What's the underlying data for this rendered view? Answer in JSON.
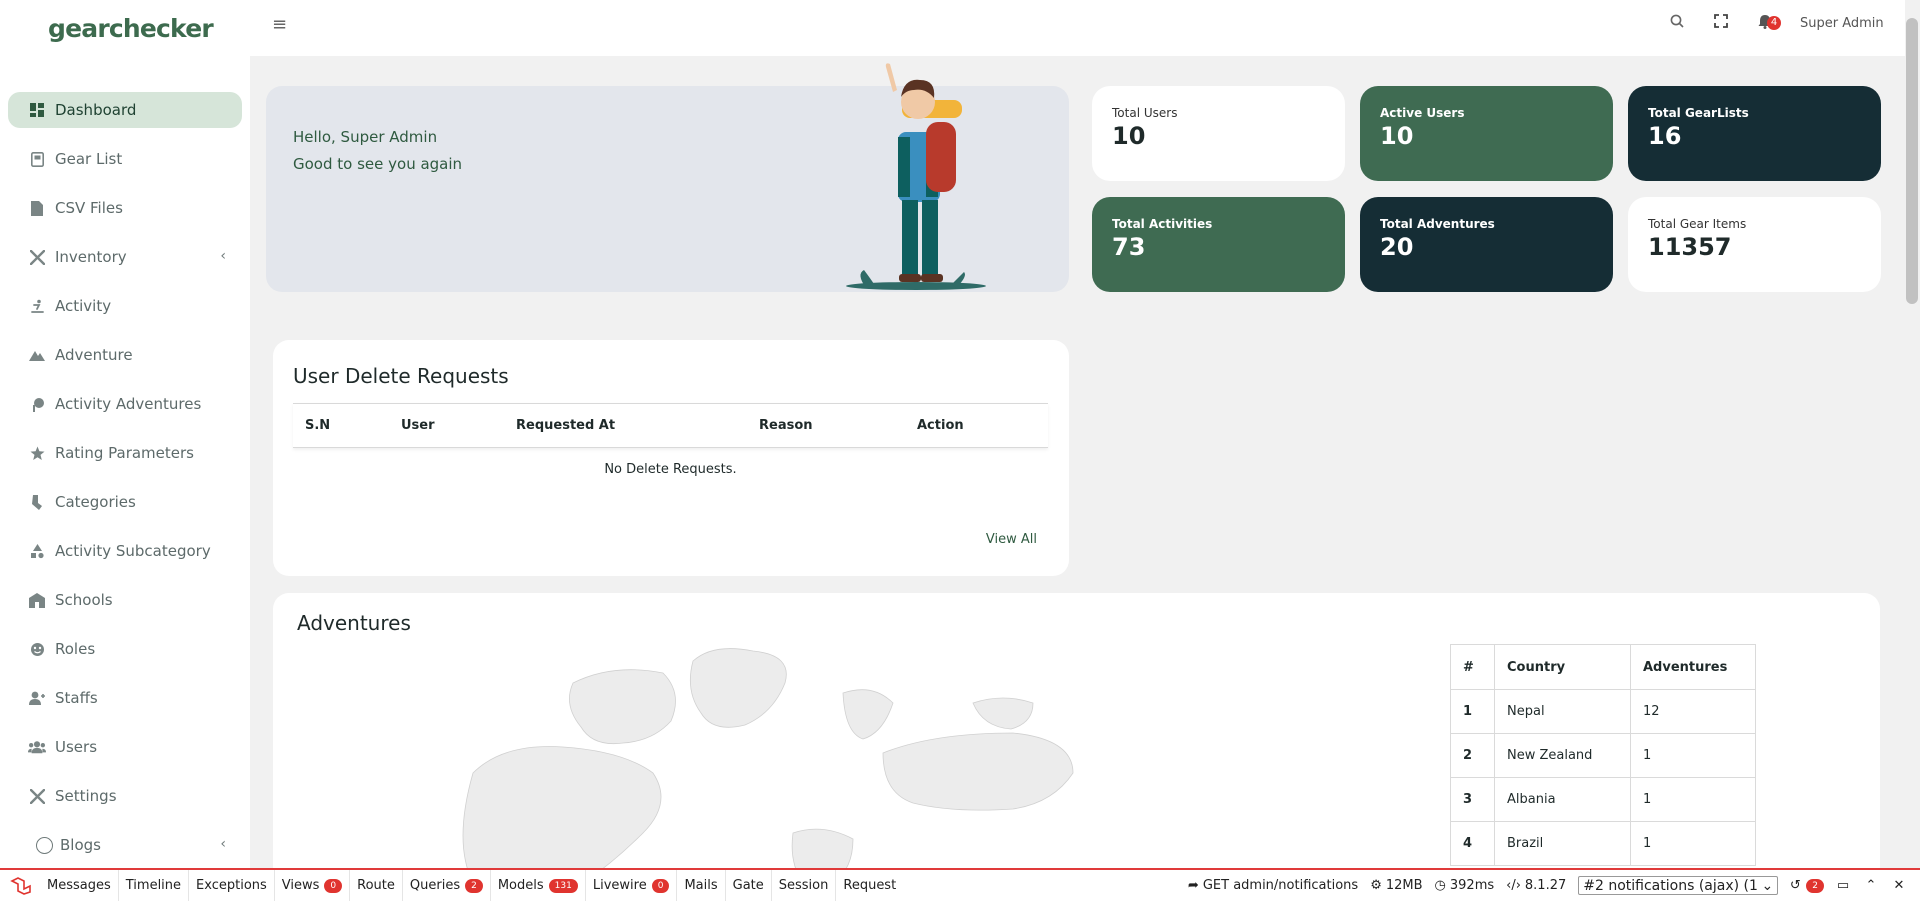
{
  "app": {
    "logo": "gearchecker"
  },
  "sidebar": {
    "items": [
      {
        "label": "Dashboard",
        "icon": "dashboard-icon",
        "active": true
      },
      {
        "label": "Gear List",
        "icon": "list-icon"
      },
      {
        "label": "CSV Files",
        "icon": "file-icon"
      },
      {
        "label": "Inventory",
        "icon": "tools-icon",
        "chevron": "‹"
      },
      {
        "label": "Activity",
        "icon": "skiing-icon"
      },
      {
        "label": "Adventure",
        "icon": "mountain-icon"
      },
      {
        "label": "Activity Adventures",
        "icon": "tree-icon"
      },
      {
        "label": "Rating Parameters",
        "icon": "star-icon"
      },
      {
        "label": "Categories",
        "icon": "sock-icon"
      },
      {
        "label": "Activity Subcategory",
        "icon": "shapes-icon"
      },
      {
        "label": "Schools",
        "icon": "school-icon"
      },
      {
        "label": "Roles",
        "icon": "masks-icon"
      },
      {
        "label": "Staffs",
        "icon": "user-tie-icon"
      },
      {
        "label": "Users",
        "icon": "users-icon"
      },
      {
        "label": "Settings",
        "icon": "tools-icon"
      },
      {
        "label": "Blogs",
        "icon": "circle-icon",
        "chevron": "‹"
      }
    ]
  },
  "topbar": {
    "user": "Super Admin",
    "notification_count": "4"
  },
  "welcome": {
    "hello": "Hello, Super Admin",
    "sub": "Good to see you again"
  },
  "stats": [
    {
      "label": "Total Users",
      "value": "10",
      "style": "white"
    },
    {
      "label": "Active Users",
      "value": "10",
      "style": "green"
    },
    {
      "label": "Total GearLists",
      "value": "16",
      "style": "dark"
    },
    {
      "label": "Total Activities",
      "value": "73",
      "style": "green"
    },
    {
      "label": "Total Adventures",
      "value": "20",
      "style": "dark"
    },
    {
      "label": "Total Gear Items",
      "value": "11357",
      "style": "white"
    }
  ],
  "delete_requests": {
    "title": "User Delete Requests",
    "columns": [
      "S.N",
      "User",
      "Requested At",
      "Reason",
      "Action"
    ],
    "empty": "No Delete Requests.",
    "view_all": "View All"
  },
  "adventures": {
    "title": "Adventures",
    "columns": [
      "#",
      "Country",
      "Adventures"
    ],
    "rows": [
      [
        "1",
        "Nepal",
        "12"
      ],
      [
        "2",
        "New Zealand",
        "1"
      ],
      [
        "3",
        "Albania",
        "1"
      ],
      [
        "4",
        "Brazil",
        "1"
      ]
    ]
  },
  "debugbar": {
    "tabs": [
      {
        "label": "Messages"
      },
      {
        "label": "Timeline"
      },
      {
        "label": "Exceptions"
      },
      {
        "label": "Views",
        "badge": "0"
      },
      {
        "label": "Route"
      },
      {
        "label": "Queries",
        "badge": "2"
      },
      {
        "label": "Models",
        "badge": "131"
      },
      {
        "label": "Livewire",
        "badge": "0"
      },
      {
        "label": "Mails"
      },
      {
        "label": "Gate"
      },
      {
        "label": "Session"
      },
      {
        "label": "Request"
      }
    ],
    "request": "GET admin/notifications",
    "memory": "12MB",
    "time": "392ms",
    "php": "8.1.27",
    "select": "#2 notifications (ajax) (1",
    "history_count": "2"
  },
  "colors": {
    "brand": "#3d6b4e",
    "green_card": "#3f6b52",
    "dark_card": "#152d35",
    "active_nav": "#d6e5d9",
    "badge_red": "#e0342f"
  }
}
